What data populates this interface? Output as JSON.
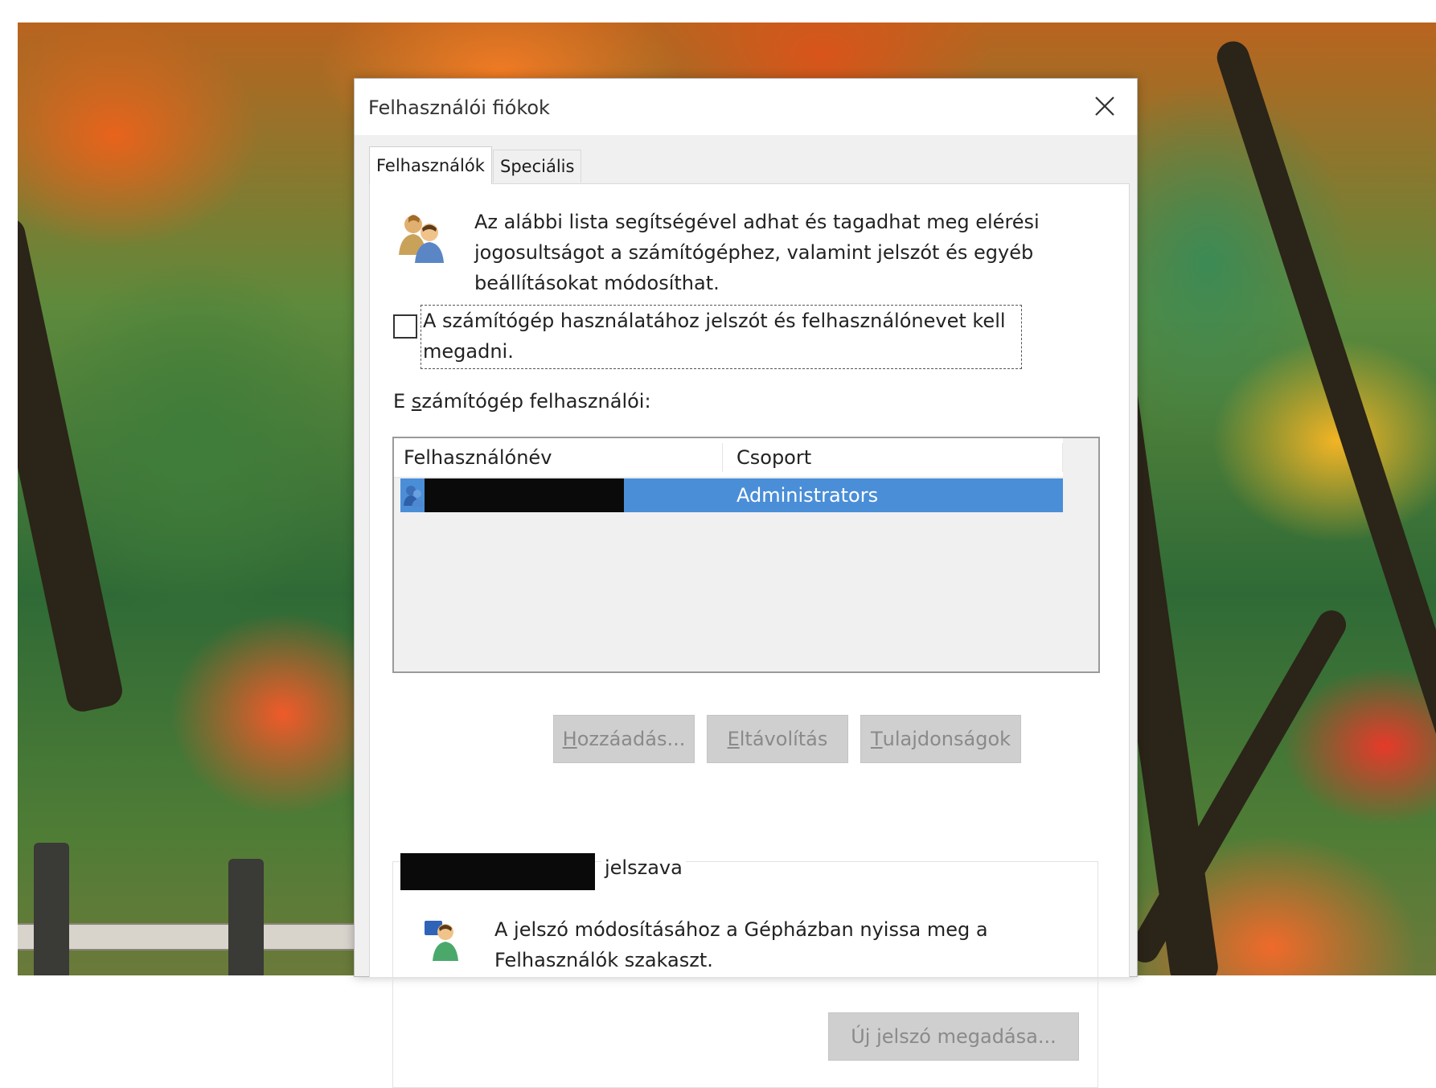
{
  "dialog": {
    "title": "Felhasználói fiókok"
  },
  "tabs": [
    {
      "label": "Felhasználók",
      "active": true
    },
    {
      "label": "Speciális",
      "active": false
    }
  ],
  "intro_text": "Az alábbi lista segítségével adhat és tagadhat meg elérési jogosultságot a számítógéphez, valamint jelszót és egyéb beállításokat módosíthat.",
  "require_password": {
    "label": "A számítógép használatához jelszót és felhasználónevet kell megadni.",
    "checked": false
  },
  "users_section": {
    "heading_prefix": "E ",
    "heading_accel": "s",
    "heading_rest": "zámítógép felhasználói:",
    "columns": [
      "Felhasználónév",
      "Csoport"
    ],
    "rows": [
      {
        "username_redacted": true,
        "group": "Administrators",
        "selected": true
      }
    ]
  },
  "buttons": {
    "add_accel": "H",
    "add_rest": "ozzáadás...",
    "remove_accel": "E",
    "remove_rest": "ltávolítás",
    "properties_accel": "T",
    "properties_rest": "ulajdonságok",
    "new_password": "Új jelszó megadása...",
    "add_enabled": false,
    "remove_enabled": false,
    "properties_enabled": false,
    "new_password_enabled": false
  },
  "password_group": {
    "legend_suffix": "jelszava",
    "text": "A jelszó módosításához a Gépházban nyissa meg a Felhasználók szakaszt."
  },
  "icons": {
    "close": "close-icon",
    "users": "users-icon",
    "user_row": "user-icon",
    "password": "user-key-icon"
  },
  "colors": {
    "selection": "#4a8ed8",
    "dialog_bg": "#f0f0f0",
    "disabled_button": "#cfcfcf"
  }
}
